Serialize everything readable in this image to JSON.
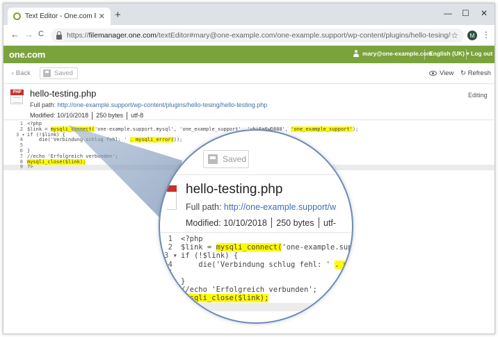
{
  "browser": {
    "tab_title": "Text Editor - One.com File Manag",
    "tab_close": "✕",
    "new_tab": "+",
    "minimize": "—",
    "maximize": "☐",
    "close": "✕",
    "back": "←",
    "forward": "→",
    "reload": "C",
    "url_prefix": "https://",
    "url_host": "filemanager.one.com",
    "url_path": "/textEditor#mary@one-example.com/one-example.support/wp-content/plugins/hello-tesing/hello-testing.php",
    "bookmark": "☆",
    "avatar_letter": "M",
    "menu": "⋮"
  },
  "app_header": {
    "logo": "one.com",
    "user": "mary@one-example.com",
    "language": "English (UK) ▾",
    "logout": "Log out"
  },
  "toolbar": {
    "back": "‹  Back",
    "saved": "Saved",
    "view": "View",
    "refresh": "↻  Refresh"
  },
  "file": {
    "icon_label": "PHP",
    "name": "hello-testing.php",
    "path_label": "Full path:",
    "path_url": "http://one-example.support/wp-content/plugins/hello-tesing/hello-testing.php",
    "path_url_magnified": "http://one-example.support/w",
    "modified_label": "Modified:",
    "modified_date": "10/10/2018",
    "size": "250 bytes",
    "encoding": "utf-8",
    "encoding_magnified": "utf-",
    "status": "Editing"
  },
  "code_lines": [
    {
      "n": "1",
      "text": "<?php"
    },
    {
      "n": "2",
      "pre": "$link = ",
      "hl1": "mysqli_connect(",
      "mid": "'one-example.support.mysql', 'one_example_support', 'yhi6a6wD888', ",
      "hl2": "'one_example_support'",
      "post": ");"
    },
    {
      "n": "3 ▾",
      "text": "if (!$link) {"
    },
    {
      "n": "4",
      "pre": "    die('Verbindung schlug fehl: ' ",
      "hl1": ". mysqli_error(",
      "post": "));"
    },
    {
      "n": "5",
      "text": ""
    },
    {
      "n": "6",
      "text": "}"
    },
    {
      "n": "7",
      "text": "//echo 'Erfolgreich verbunden';"
    },
    {
      "n": "8",
      "hl1": "mysqli_close($link);"
    },
    {
      "n": "9",
      "text": "?>"
    }
  ],
  "magnified_code": [
    {
      "n": "1",
      "text": "<?php"
    },
    {
      "n": "2",
      "pre": "$link = ",
      "hl1": "mysqli_connect(",
      "mid": "'one-example.sup"
    },
    {
      "n": "3 ▾",
      "text": "if (!$link) {"
    },
    {
      "n": "4",
      "pre": "    die('Verbindung schlug fehl: ' ",
      "hl1": ". m"
    },
    {
      "n": "5",
      "text": ""
    },
    {
      "n": "6",
      "text": "}"
    },
    {
      "n": "7",
      "text": "//echo 'Erfolgreich verbunden';"
    },
    {
      "n": "8",
      "hl1": "mysqli_close($link);"
    },
    {
      "n": "",
      "text": ""
    }
  ],
  "colors": {
    "brand_green": "#7aa33c",
    "highlight": "#fffb00",
    "link": "#3f6fae",
    "magnifier_border": "#6e8bb3"
  }
}
